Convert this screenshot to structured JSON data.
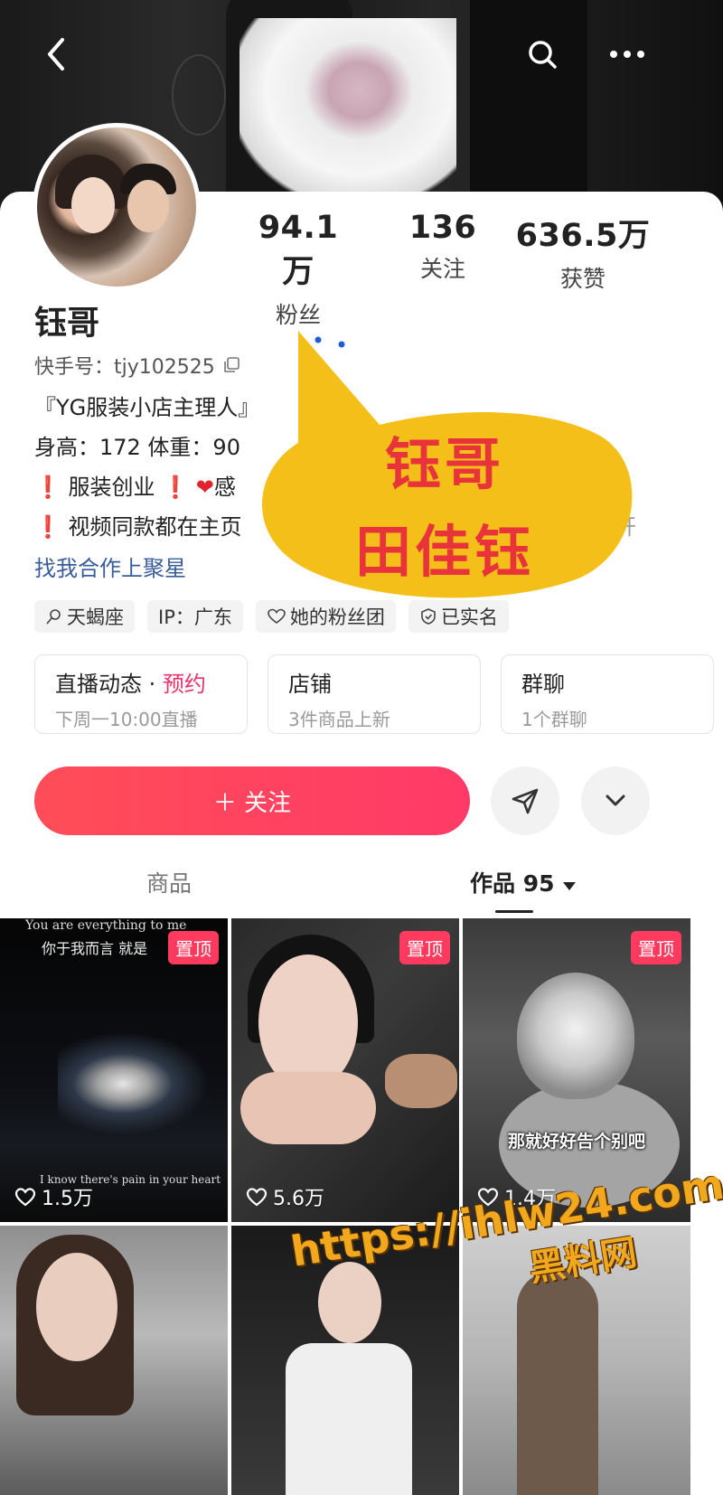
{
  "profile": {
    "stats": [
      {
        "value": "94.1万",
        "label": "粉丝"
      },
      {
        "value": "136",
        "label": "关注"
      },
      {
        "value": "636.5万",
        "label": "获赞"
      }
    ],
    "name": "钰哥",
    "handle": "快手号：tjy102525",
    "bio": {
      "line1": "『YG服装小店主理人』",
      "line2": "身高：172 体重：90",
      "line3_a": "服装创业",
      "line3_b": "感",
      "line4": "视频同款都在主页",
      "line4_tail": "开"
    },
    "collab_link": "找我合作上聚星",
    "tags": [
      "天蝎座",
      "IP：广东",
      "她的粉丝团",
      "已实名"
    ]
  },
  "feature_cards": [
    {
      "title": "直播动态 · ",
      "title_accent": "预约",
      "subtitle": "下周一10:00直播"
    },
    {
      "title": "店铺",
      "title_accent": "",
      "subtitle": "3件商品上新"
    },
    {
      "title": "群聊",
      "title_accent": "",
      "subtitle": "1个群聊"
    }
  ],
  "actions": {
    "follow_label": "＋ 关注"
  },
  "tabs": {
    "goods": "商品",
    "works": "作品 95"
  },
  "videos": [
    {
      "likes": "1.5万",
      "pinned": "置顶",
      "caption_top_en": "You are everything to me",
      "caption_top_cn": "你于我而言 就是",
      "caption_bottom": "I know there's pain in your heart"
    },
    {
      "likes": "5.6万",
      "pinned": "置顶"
    },
    {
      "likes": "1.4万",
      "pinned": "置顶",
      "subtitle": "那就好好告个别吧"
    },
    {
      "likes": ""
    },
    {
      "likes": ""
    },
    {
      "likes": ""
    }
  ],
  "overlay": {
    "line1": "钰哥",
    "line2": "田佳钰"
  },
  "watermark": {
    "url": "https://ihlw24.com",
    "name": "黑料网"
  },
  "icons": [
    "back-arrow-icon",
    "search-icon",
    "more-icon",
    "copy-icon",
    "scorpio-icon",
    "heart-outline-icon",
    "shield-check-icon",
    "send-icon",
    "chevron-down-icon",
    "caret-down-icon"
  ],
  "colors": {
    "follow_gradient_start": "#ff4d58",
    "follow_gradient_end": "#ff3a67",
    "pinned": "#ff3a5f",
    "accent_pink": "#e9336a",
    "link_blue": "#3a5d9a",
    "bubble_yellow": "#f5bf19",
    "bubble_text_red": "#e8333a"
  }
}
